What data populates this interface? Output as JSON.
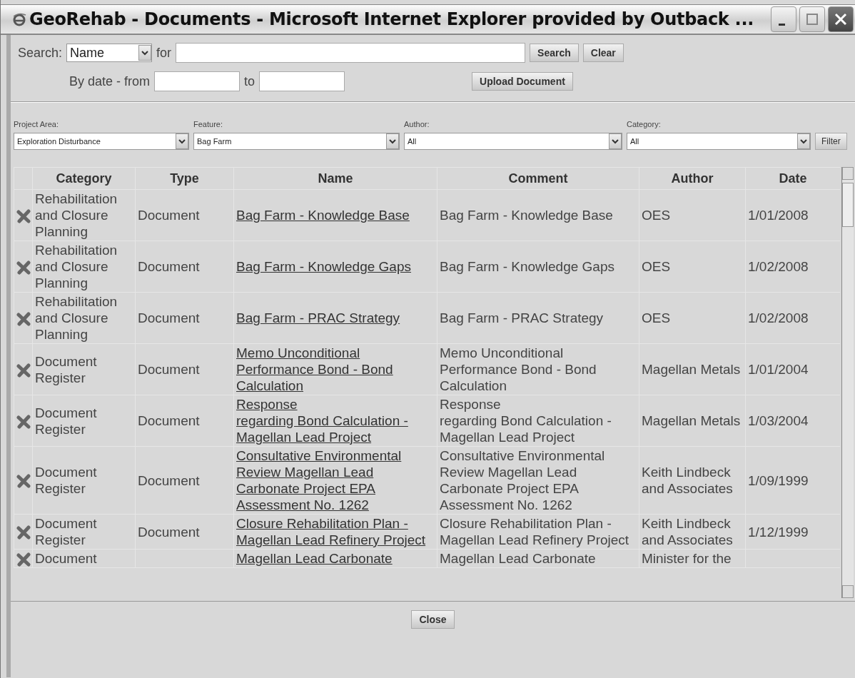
{
  "window": {
    "title": "GeoRehab - Documents - Microsoft Internet Explorer provided by Outback ..."
  },
  "search": {
    "label": "Search:",
    "field": "Name",
    "for_label": "for",
    "search_button": "Search",
    "clear_button": "Clear",
    "date_label": "By date - from",
    "to_label": "to",
    "upload_button": "Upload Document"
  },
  "filters": [
    {
      "label": "Project Area:",
      "value": "Exploration Disturbance"
    },
    {
      "label": "Feature:",
      "value": "Bag Farm"
    },
    {
      "label": "Author:",
      "value": "All"
    },
    {
      "label": "Category:",
      "value": "All"
    }
  ],
  "filter_button": "Filter",
  "table": {
    "columns": [
      "Category",
      "Type",
      "Name",
      "Comment",
      "Author",
      "Date"
    ],
    "rows": [
      {
        "category": "Rehabilitation and Closure Planning",
        "type": "Document",
        "name": "Bag Farm - Knowledge Base",
        "comment": "Bag Farm - Knowledge Base",
        "author": "OES",
        "date": "1/01/2008"
      },
      {
        "category": "Rehabilitation and Closure Planning",
        "type": "Document",
        "name": "Bag Farm - Knowledge Gaps",
        "comment": "Bag Farm - Knowledge Gaps",
        "author": "OES",
        "date": "1/02/2008"
      },
      {
        "category": "Rehabilitation and Closure Planning",
        "type": "Document",
        "name": "Bag Farm - PRAC Strategy",
        "comment": "Bag Farm - PRAC Strategy",
        "author": "OES",
        "date": "1/02/2008"
      },
      {
        "category": "Document Register",
        "type": "Document",
        "name": "Memo Unconditional Performance Bond - Bond Calculation",
        "comment": "Memo Unconditional Performance Bond - Bond Calculation",
        "author": "Magellan Metals",
        "date": "1/01/2004"
      },
      {
        "category": "Document Register",
        "type": "Document",
        "name": "Response\nregarding Bond Calculation - Magellan Lead Project",
        "comment": "Response\nregarding Bond Calculation - Magellan Lead Project",
        "author": "Magellan Metals",
        "date": "1/03/2004"
      },
      {
        "category": "Document Register",
        "type": "Document",
        "name": "Consultative Environmental Review Magellan Lead Carbonate Project EPA Assessment No. 1262",
        "comment": "Consultative Environmental Review Magellan Lead Carbonate Project EPA Assessment No. 1262",
        "author": "Keith Lindbeck and Associates",
        "date": "1/09/1999"
      },
      {
        "category": "Document Register",
        "type": "Document",
        "name": "Closure Rehabilitation Plan - Magellan Lead Refinery Project",
        "comment": "Closure Rehabilitation Plan - Magellan Lead Refinery Project",
        "author": "Keith Lindbeck and Associates",
        "date": "1/12/1999"
      },
      {
        "category": "Document",
        "name": "Magellan Lead Carbonate",
        "comment": "Magellan Lead Carbonate",
        "author": "Minister for the"
      }
    ]
  },
  "close_button": "Close"
}
